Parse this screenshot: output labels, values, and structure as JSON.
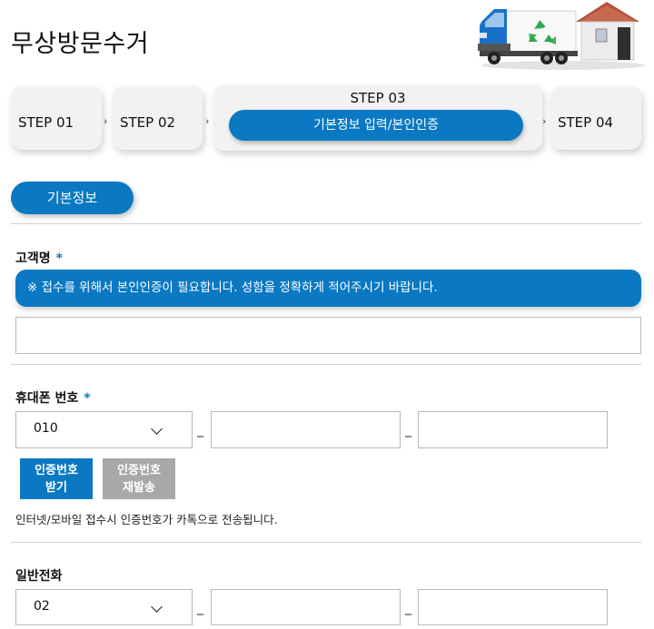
{
  "header": {
    "title": "무상방문수거",
    "illustration": "recycling-truck-and-house"
  },
  "steps": [
    {
      "label": "STEP 01"
    },
    {
      "label": "STEP 02"
    },
    {
      "label": "STEP 03",
      "sublabel": "기본정보 입력/본인인증",
      "active": true
    },
    {
      "label": "STEP 04"
    }
  ],
  "step_separator_icon": "chevron-right-icon",
  "section": {
    "tab_label": "기본정보"
  },
  "form": {
    "name": {
      "label": "고객명",
      "required_mark": "*",
      "notice": "※ 접수를 위해서 본인인증이 필요합니다. 성함을 정확하게 적어주시기 바랍니다.",
      "value": ""
    },
    "mobile": {
      "label": "휴대폰 번호",
      "required_mark": "*",
      "prefix": "010",
      "separator": "_",
      "middle": "",
      "last": "",
      "auth_button_line1": "인증번호",
      "auth_button_line2": "받기",
      "resend_button_line1": "인증번호",
      "resend_button_line2": "재발송",
      "help_text": "인터넷/모바일 접수시 인증번호가 카톡으로 전송됩니다."
    },
    "landline": {
      "label": "일반전화",
      "prefix": "02",
      "separator": "_",
      "middle": "",
      "last": ""
    }
  },
  "colors": {
    "accent": "#0a78c2",
    "disabled": "#a8a8a8",
    "step_bg": "#f2f2f2",
    "divider": "#cfcfcf"
  }
}
